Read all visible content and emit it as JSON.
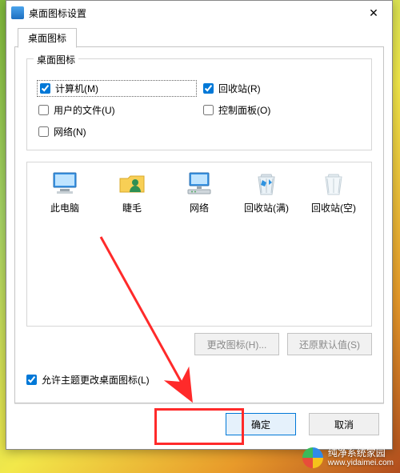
{
  "window": {
    "title": "桌面图标设置",
    "close_glyph": "✕"
  },
  "tab": {
    "label": "桌面图标"
  },
  "group": {
    "legend": "桌面图标",
    "items": [
      {
        "key": "computer",
        "label": "计算机(M)",
        "checked": true,
        "focused": true
      },
      {
        "key": "recycle",
        "label": "回收站(R)",
        "checked": true,
        "focused": false
      },
      {
        "key": "userfiles",
        "label": "用户的文件(U)",
        "checked": false,
        "focused": false
      },
      {
        "key": "cpanel",
        "label": "控制面板(O)",
        "checked": false,
        "focused": false
      },
      {
        "key": "network",
        "label": "网络(N)",
        "checked": false,
        "focused": false
      }
    ]
  },
  "icons": [
    {
      "name": "this-pc",
      "label": "此电脑"
    },
    {
      "name": "user-folder",
      "label": "睫毛"
    },
    {
      "name": "network",
      "label": "网络"
    },
    {
      "name": "recycle-full",
      "label": "回收站(满)"
    },
    {
      "name": "recycle-empty",
      "label": "回收站(空)"
    }
  ],
  "buttons": {
    "change_icon": "更改图标(H)...",
    "restore_default": "还原默认值(S)",
    "ok": "确定",
    "cancel": "取消"
  },
  "theme_checkbox": {
    "label": "允许主题更改桌面图标(L)",
    "checked": true
  },
  "watermark": {
    "line1": "纯净系统家园",
    "line2": "www.yidaimei.com"
  }
}
